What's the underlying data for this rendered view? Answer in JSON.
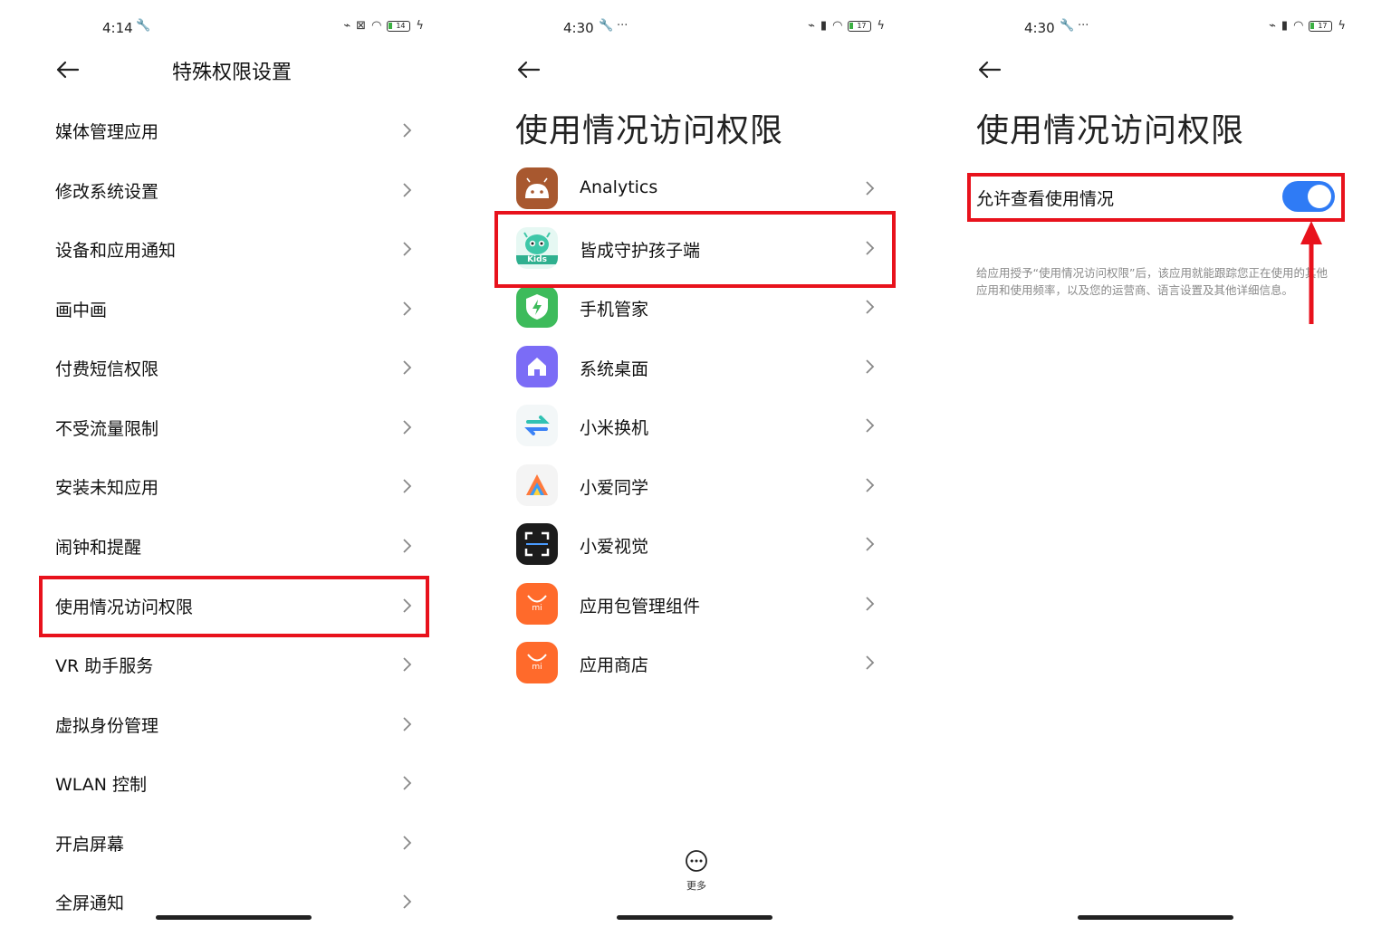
{
  "panel1": {
    "status": {
      "time": "4:14",
      "battery": "14"
    },
    "title": "特殊权限设置",
    "items": [
      {
        "label": "媒体管理应用"
      },
      {
        "label": "修改系统设置"
      },
      {
        "label": "设备和应用通知"
      },
      {
        "label": "画中画"
      },
      {
        "label": "付费短信权限"
      },
      {
        "label": "不受流量限制"
      },
      {
        "label": "安装未知应用"
      },
      {
        "label": "闹钟和提醒"
      },
      {
        "label": "使用情况访问权限"
      },
      {
        "label": "VR 助手服务"
      },
      {
        "label": "虚拟身份管理"
      },
      {
        "label": "WLAN 控制"
      },
      {
        "label": "开启屏幕"
      },
      {
        "label": "全屏通知"
      }
    ],
    "highlighted_item": "使用情况访问权限"
  },
  "panel2": {
    "status": {
      "time": "4:30",
      "extra": "···",
      "battery": "17"
    },
    "title": "使用情况访问权限",
    "apps": [
      {
        "label": "Analytics",
        "icon": "android-icon",
        "color": "#a0522d"
      },
      {
        "label": "皆成守护孩子端",
        "icon": "kids-icon",
        "color": "#3ec7a8"
      },
      {
        "label": "手机管家",
        "icon": "shield-icon",
        "color": "#3dbb5b"
      },
      {
        "label": "系统桌面",
        "icon": "home-icon",
        "color": "#7b6cf6"
      },
      {
        "label": "小米换机",
        "icon": "swap-icon",
        "color": "#31c2b3"
      },
      {
        "label": "小爱同学",
        "icon": "xiaoai-icon",
        "color": "#ff7a3c"
      },
      {
        "label": "小爱视觉",
        "icon": "scan-icon",
        "color": "#1c1c1c"
      },
      {
        "label": "应用包管理组件",
        "icon": "mi-bag-icon",
        "color": "#ff6a2b"
      },
      {
        "label": "应用商店",
        "icon": "mi-store-icon",
        "color": "#ff6a2b"
      }
    ],
    "kids_badge": "Kids",
    "mi_badge": "mi",
    "highlighted_app": "皆成守护孩子端",
    "more_label": "更多"
  },
  "panel3": {
    "status": {
      "time": "4:30",
      "extra": "···",
      "battery": "17"
    },
    "title": "使用情况访问权限",
    "toggle_label": "允许查看使用情况",
    "toggle_on": true,
    "description": "给应用授予“使用情况访问权限”后，该应用就能跟踪您正在使用的其他应用和使用频率，以及您的运营商、语言设置及其他详细信息。"
  },
  "colors": {
    "highlight": "#e8121c",
    "toggle": "#2f7bf5",
    "description": "#8a8a8a"
  }
}
